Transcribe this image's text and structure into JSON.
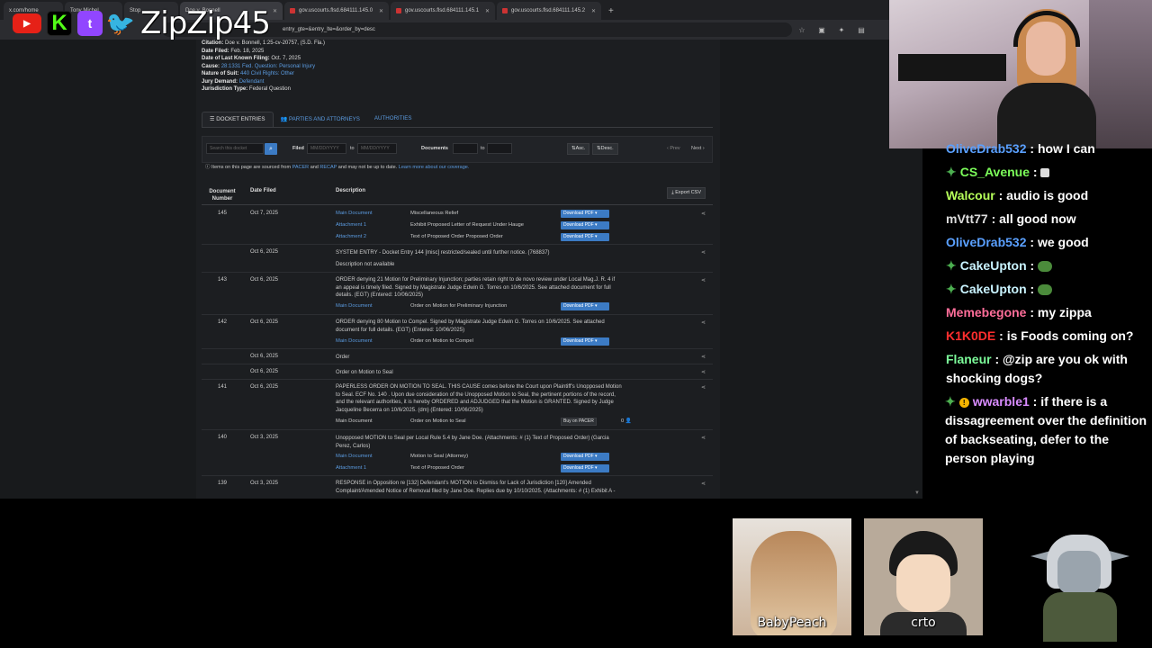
{
  "browser": {
    "tabs": [
      {
        "label": "x.com/home"
      },
      {
        "label": "Tony Michel"
      },
      {
        "label": "Stop"
      },
      {
        "label": "Doe v. Bonnell"
      },
      {
        "label": "gov.uscourts.flsd.684111.145.0"
      },
      {
        "label": "gov.uscourts.flsd.684111.145.1"
      },
      {
        "label": "gov.uscourts.flsd.684111.145.2"
      }
    ],
    "new_tab": "+",
    "url": "entry_gte=&entry_lte=&order_by=desc"
  },
  "overlay": {
    "youtube": "▶",
    "kick": "K",
    "twitch": "t",
    "twitter": "🐦",
    "handle": "ZipZip45"
  },
  "case": {
    "citation_label": "Citation:",
    "citation_value": "Doe v. Bonnell, 1:25-cv-20757, (S.D. Fla.)",
    "filed_label": "Date Filed:",
    "filed_value": "Feb. 18, 2025",
    "last_filing_label": "Date of Last Known Filing:",
    "last_filing_value": "Oct. 7, 2025",
    "cause_label": "Cause:",
    "cause_value": "28:1331 Fed. Question: Personal Injury",
    "nature_label": "Nature of Suit:",
    "nature_value": "440 Civil Rights: Other",
    "jury_label": "Jury Demand:",
    "jury_value": "Defendant",
    "jurisdiction_label": "Jurisdiction Type:",
    "jurisdiction_value": "Federal Question"
  },
  "page_tabs": {
    "docket": "DOCKET ENTRIES",
    "parties": "PARTIES AND ATTORNEYS",
    "authorities": "AUTHORITIES"
  },
  "filters": {
    "search_placeholder": "Search this docket",
    "filed_label": "Filed",
    "date_placeholder": "MM/DD/YYYY",
    "to_label": "to",
    "documents_label": "Documents",
    "asc": "Asc.",
    "desc": "Desc.",
    "prev": "‹ Prev",
    "next": "Next ›"
  },
  "notice": {
    "prefix": "Items on this page are sourced from",
    "pacer": "PACER",
    "and": "and",
    "recap": "RECAP",
    "suffix": "and may not be up to date.",
    "learn_more": "Learn more about our coverage."
  },
  "table": {
    "col_number": "Document Number",
    "col_date": "Date Filed",
    "col_description": "Description",
    "export": "Export CSV",
    "download_label": "Download PDF ▾",
    "buy_label": "Buy on PACER",
    "buy_count": "0 👤",
    "rows": [
      {
        "num": "145",
        "date": "Oct 7, 2025",
        "desc": "",
        "attachments": [
          {
            "name": "Main Document",
            "desc": "Miscellaneous Relief"
          },
          {
            "name": "Attachment 1",
            "desc": "Exhibit Proposed Letter of Request Under Hauge"
          },
          {
            "name": "Attachment 2",
            "desc": "Text of Proposed Order Proposed Order"
          }
        ]
      },
      {
        "num": "",
        "date": "Oct 6, 2025",
        "desc": "SYSTEM ENTRY - Docket Entry 144 [misc] restricted/sealed until further notice. (768837)",
        "desc2": "Description not available"
      },
      {
        "num": "143",
        "date": "Oct 6, 2025",
        "desc": "ORDER denying 21 Motion for Preliminary Injunction; parties retain right to de novo review under Local Mag.J. R. 4 if an appeal is timely filed. Signed by Magistrate Judge Edwin G. Torres on 10/6/2025. See attached document for full details. (EGT) (Entered: 10/06/2025)",
        "attachments": [
          {
            "name": "Main Document",
            "desc": "Order on Motion for Preliminary Injunction"
          }
        ]
      },
      {
        "num": "142",
        "date": "Oct 6, 2025",
        "desc": "ORDER denying 80 Motion to Compel. Signed by Magistrate Judge Edwin G. Torres on 10/6/2025. See attached document for full details. (EGT) (Entered: 10/06/2025)",
        "attachments": [
          {
            "name": "Main Document",
            "desc": "Order on Motion to Compel"
          }
        ]
      },
      {
        "num": "",
        "date": "Oct 6, 2025",
        "desc": "Order"
      },
      {
        "num": "",
        "date": "Oct 6, 2025",
        "desc": "Order on Motion to Seal"
      },
      {
        "num": "141",
        "date": "Oct 6, 2025",
        "desc": "PAPERLESS ORDER ON MOTION TO SEAL. THIS CAUSE comes before the Court upon Plaintiff's Unopposed Motion to Seal. ECF No. 140 . Upon due consideration of the Unopposed Motion to Seal, the pertinent portions of the record, and the relevant authorities, it is hereby ORDERED and ADJUDGED that the Motion is GRANTED. Signed by Judge Jacqueline Becerra on 10/6/2025. (dm) (Entered: 10/06/2025)",
        "attachments": [
          {
            "name": "Main Document",
            "desc": "Order on Motion to Seal"
          }
        ]
      },
      {
        "num": "140",
        "date": "Oct 3, 2025",
        "desc": "Unopposed MOTION to Seal per Local Rule 5.4 by Jane Doe. (Attachments: # (1) Text of Proposed Order) (Garcia Perez, Carlos)",
        "attachments": [
          {
            "name": "Main Document",
            "desc": "Motion to Seal (Attorney)"
          },
          {
            "name": "Attachment 1",
            "desc": "Text of Proposed Order"
          }
        ]
      },
      {
        "num": "139",
        "date": "Oct 3, 2025",
        "desc": "RESPONSE in Opposition re [132] Defendant's MOTION to Dismiss for Lack of Jurisdiction [120] Amended Complaint/Amended Notice of Removal filed by Jane Doe. Replies due by 10/10/2025. (Attachments: # (1) Exhibit A -"
      }
    ]
  },
  "chat": {
    "messages": [
      {
        "user": "OliveDrab532",
        "color": "#5aa0ff",
        "text": "how I can"
      },
      {
        "user": "CS_Avenue",
        "color": "#7cfc5a",
        "text": ""
      },
      {
        "user": "Walcour",
        "color": "#b6ff5a",
        "text": "audio is good"
      },
      {
        "user": "mVtt77",
        "color": "#dddddd",
        "text": "all good now"
      },
      {
        "user": "OliveDrab532",
        "color": "#5aa0ff",
        "text": "we good"
      },
      {
        "user": "CakeUpton",
        "color": "#c9f3ff",
        "text": ""
      },
      {
        "user": "CakeUpton",
        "color": "#c9f3ff",
        "text": ""
      },
      {
        "user": "Memebegone",
        "color": "#ff6e9a",
        "text": "my zippa"
      },
      {
        "user": "K1K0DE",
        "color": "#ff2e2e",
        "text": "is Foods coming on?"
      },
      {
        "user": "Flaneur",
        "color": "#7cfc9a",
        "text": "@zip are you ok with shocking dogs?"
      },
      {
        "user": "wwarble1",
        "color": "#d98cff",
        "text": "if there is a dissagreement over the definition of backseating, defer to the person playing"
      }
    ]
  },
  "cams": {
    "left": "BabyPeach",
    "middle": "crto"
  }
}
